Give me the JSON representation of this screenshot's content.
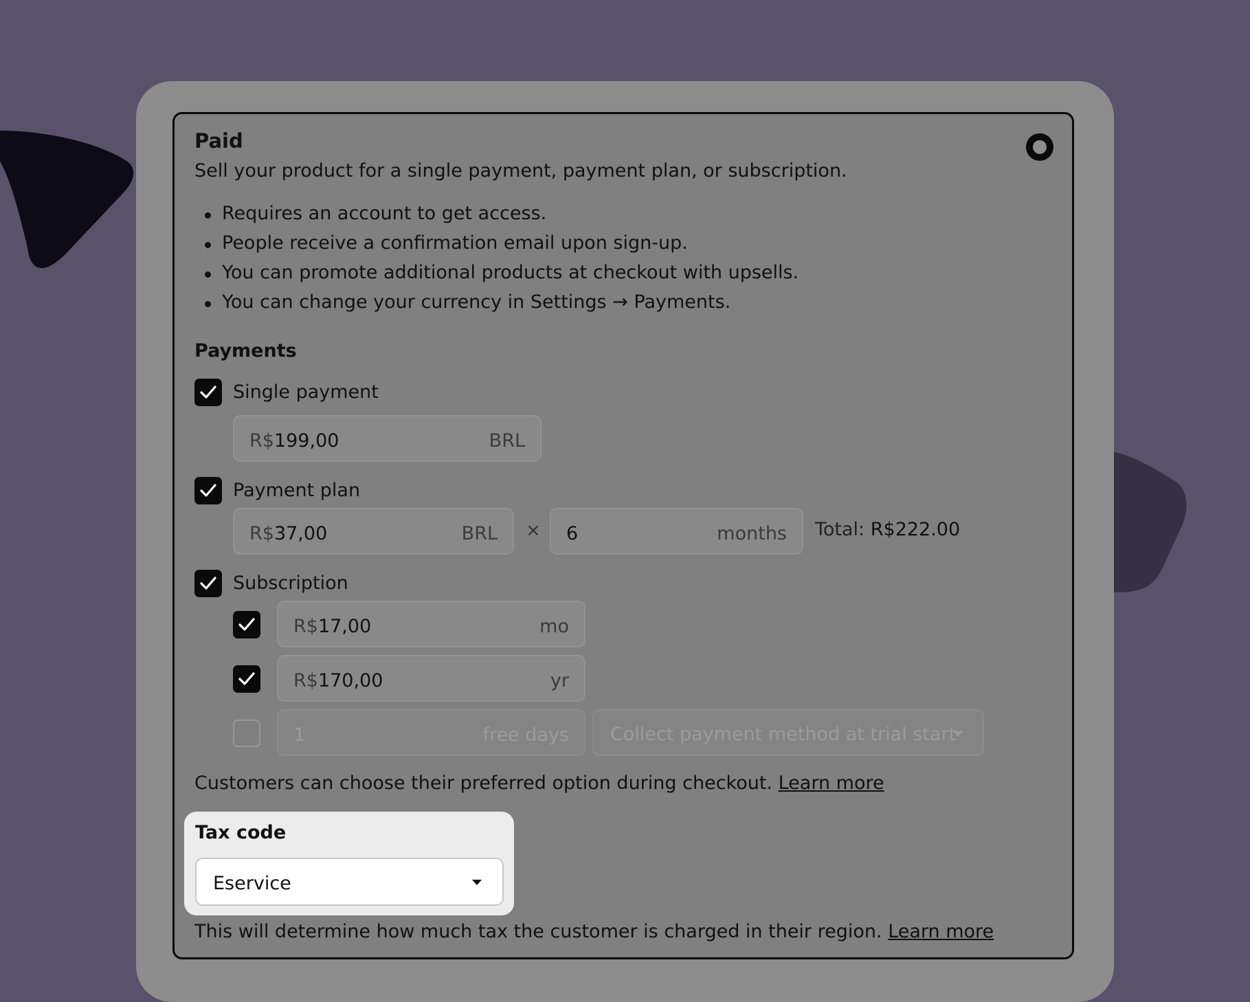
{
  "paid_option": {
    "title": "Paid",
    "description": "Sell your product for a single payment, payment plan, or subscription.",
    "bullets": [
      "Requires an account to get access.",
      "People receive a confirmation email upon sign-up.",
      "You can promote additional products at checkout with upsells.",
      "You can change your currency in Settings → Payments."
    ]
  },
  "payments": {
    "heading": "Payments",
    "single_payment": {
      "label": "Single payment",
      "checked": true,
      "currency_symbol": "R$",
      "amount": "199,00",
      "currency_code": "BRL"
    },
    "payment_plan": {
      "label": "Payment plan",
      "checked": true,
      "currency_symbol": "R$",
      "amount": "37,00",
      "currency_code": "BRL",
      "multiplier": "×",
      "count": "6",
      "count_unit": "months",
      "total_label": "Total:",
      "total_amount": "R$222.00"
    },
    "subscription": {
      "label": "Subscription",
      "checked": true,
      "monthly": {
        "checked": true,
        "currency_symbol": "R$",
        "amount": "17,00",
        "unit": "mo"
      },
      "yearly": {
        "checked": true,
        "currency_symbol": "R$",
        "amount": "170,00",
        "unit": "yr"
      },
      "trial": {
        "checked": false,
        "days_value": "1",
        "days_unit": "free days",
        "collection_option": "Collect payment method at trial start"
      }
    },
    "helper_text": "Customers can choose their preferred option during checkout.",
    "helper_link": "Learn more"
  },
  "tax": {
    "label": "Tax code",
    "selected": "Eservice",
    "helper_text": "This will determine how much tax the customer is charged in their region.",
    "helper_link": "Learn more"
  }
}
